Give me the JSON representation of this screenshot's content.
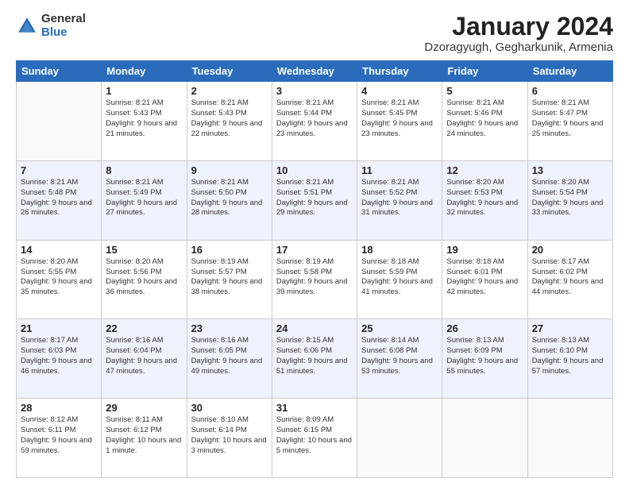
{
  "logo": {
    "general": "General",
    "blue": "Blue"
  },
  "title": "January 2024",
  "location": "Dzoragyugh, Gegharkunik, Armenia",
  "weekdays": [
    "Sunday",
    "Monday",
    "Tuesday",
    "Wednesday",
    "Thursday",
    "Friday",
    "Saturday"
  ],
  "weeks": [
    [
      {
        "day": "",
        "sunrise": "",
        "sunset": "",
        "daylight": ""
      },
      {
        "day": "1",
        "sunrise": "Sunrise: 8:21 AM",
        "sunset": "Sunset: 5:43 PM",
        "daylight": "Daylight: 9 hours and 21 minutes."
      },
      {
        "day": "2",
        "sunrise": "Sunrise: 8:21 AM",
        "sunset": "Sunset: 5:43 PM",
        "daylight": "Daylight: 9 hours and 22 minutes."
      },
      {
        "day": "3",
        "sunrise": "Sunrise: 8:21 AM",
        "sunset": "Sunset: 5:44 PM",
        "daylight": "Daylight: 9 hours and 23 minutes."
      },
      {
        "day": "4",
        "sunrise": "Sunrise: 8:21 AM",
        "sunset": "Sunset: 5:45 PM",
        "daylight": "Daylight: 9 hours and 23 minutes."
      },
      {
        "day": "5",
        "sunrise": "Sunrise: 8:21 AM",
        "sunset": "Sunset: 5:46 PM",
        "daylight": "Daylight: 9 hours and 24 minutes."
      },
      {
        "day": "6",
        "sunrise": "Sunrise: 8:21 AM",
        "sunset": "Sunset: 5:47 PM",
        "daylight": "Daylight: 9 hours and 25 minutes."
      }
    ],
    [
      {
        "day": "7",
        "sunrise": "Sunrise: 8:21 AM",
        "sunset": "Sunset: 5:48 PM",
        "daylight": "Daylight: 9 hours and 26 minutes."
      },
      {
        "day": "8",
        "sunrise": "Sunrise: 8:21 AM",
        "sunset": "Sunset: 5:49 PM",
        "daylight": "Daylight: 9 hours and 27 minutes."
      },
      {
        "day": "9",
        "sunrise": "Sunrise: 8:21 AM",
        "sunset": "Sunset: 5:50 PM",
        "daylight": "Daylight: 9 hours and 28 minutes."
      },
      {
        "day": "10",
        "sunrise": "Sunrise: 8:21 AM",
        "sunset": "Sunset: 5:51 PM",
        "daylight": "Daylight: 9 hours and 29 minutes."
      },
      {
        "day": "11",
        "sunrise": "Sunrise: 8:21 AM",
        "sunset": "Sunset: 5:52 PM",
        "daylight": "Daylight: 9 hours and 31 minutes."
      },
      {
        "day": "12",
        "sunrise": "Sunrise: 8:20 AM",
        "sunset": "Sunset: 5:53 PM",
        "daylight": "Daylight: 9 hours and 32 minutes."
      },
      {
        "day": "13",
        "sunrise": "Sunrise: 8:20 AM",
        "sunset": "Sunset: 5:54 PM",
        "daylight": "Daylight: 9 hours and 33 minutes."
      }
    ],
    [
      {
        "day": "14",
        "sunrise": "Sunrise: 8:20 AM",
        "sunset": "Sunset: 5:55 PM",
        "daylight": "Daylight: 9 hours and 35 minutes."
      },
      {
        "day": "15",
        "sunrise": "Sunrise: 8:20 AM",
        "sunset": "Sunset: 5:56 PM",
        "daylight": "Daylight: 9 hours and 36 minutes."
      },
      {
        "day": "16",
        "sunrise": "Sunrise: 8:19 AM",
        "sunset": "Sunset: 5:57 PM",
        "daylight": "Daylight: 9 hours and 38 minutes."
      },
      {
        "day": "17",
        "sunrise": "Sunrise: 8:19 AM",
        "sunset": "Sunset: 5:58 PM",
        "daylight": "Daylight: 9 hours and 39 minutes."
      },
      {
        "day": "18",
        "sunrise": "Sunrise: 8:18 AM",
        "sunset": "Sunset: 5:59 PM",
        "daylight": "Daylight: 9 hours and 41 minutes."
      },
      {
        "day": "19",
        "sunrise": "Sunrise: 8:18 AM",
        "sunset": "Sunset: 6:01 PM",
        "daylight": "Daylight: 9 hours and 42 minutes."
      },
      {
        "day": "20",
        "sunrise": "Sunrise: 8:17 AM",
        "sunset": "Sunset: 6:02 PM",
        "daylight": "Daylight: 9 hours and 44 minutes."
      }
    ],
    [
      {
        "day": "21",
        "sunrise": "Sunrise: 8:17 AM",
        "sunset": "Sunset: 6:03 PM",
        "daylight": "Daylight: 9 hours and 46 minutes."
      },
      {
        "day": "22",
        "sunrise": "Sunrise: 8:16 AM",
        "sunset": "Sunset: 6:04 PM",
        "daylight": "Daylight: 9 hours and 47 minutes."
      },
      {
        "day": "23",
        "sunrise": "Sunrise: 8:16 AM",
        "sunset": "Sunset: 6:05 PM",
        "daylight": "Daylight: 9 hours and 49 minutes."
      },
      {
        "day": "24",
        "sunrise": "Sunrise: 8:15 AM",
        "sunset": "Sunset: 6:06 PM",
        "daylight": "Daylight: 9 hours and 51 minutes."
      },
      {
        "day": "25",
        "sunrise": "Sunrise: 8:14 AM",
        "sunset": "Sunset: 6:08 PM",
        "daylight": "Daylight: 9 hours and 53 minutes."
      },
      {
        "day": "26",
        "sunrise": "Sunrise: 8:13 AM",
        "sunset": "Sunset: 6:09 PM",
        "daylight": "Daylight: 9 hours and 55 minutes."
      },
      {
        "day": "27",
        "sunrise": "Sunrise: 8:13 AM",
        "sunset": "Sunset: 6:10 PM",
        "daylight": "Daylight: 9 hours and 57 minutes."
      }
    ],
    [
      {
        "day": "28",
        "sunrise": "Sunrise: 8:12 AM",
        "sunset": "Sunset: 6:11 PM",
        "daylight": "Daylight: 9 hours and 59 minutes."
      },
      {
        "day": "29",
        "sunrise": "Sunrise: 8:11 AM",
        "sunset": "Sunset: 6:12 PM",
        "daylight": "Daylight: 10 hours and 1 minute."
      },
      {
        "day": "30",
        "sunrise": "Sunrise: 8:10 AM",
        "sunset": "Sunset: 6:14 PM",
        "daylight": "Daylight: 10 hours and 3 minutes."
      },
      {
        "day": "31",
        "sunrise": "Sunrise: 8:09 AM",
        "sunset": "Sunset: 6:15 PM",
        "daylight": "Daylight: 10 hours and 5 minutes."
      },
      {
        "day": "",
        "sunrise": "",
        "sunset": "",
        "daylight": ""
      },
      {
        "day": "",
        "sunrise": "",
        "sunset": "",
        "daylight": ""
      },
      {
        "day": "",
        "sunrise": "",
        "sunset": "",
        "daylight": ""
      }
    ]
  ]
}
